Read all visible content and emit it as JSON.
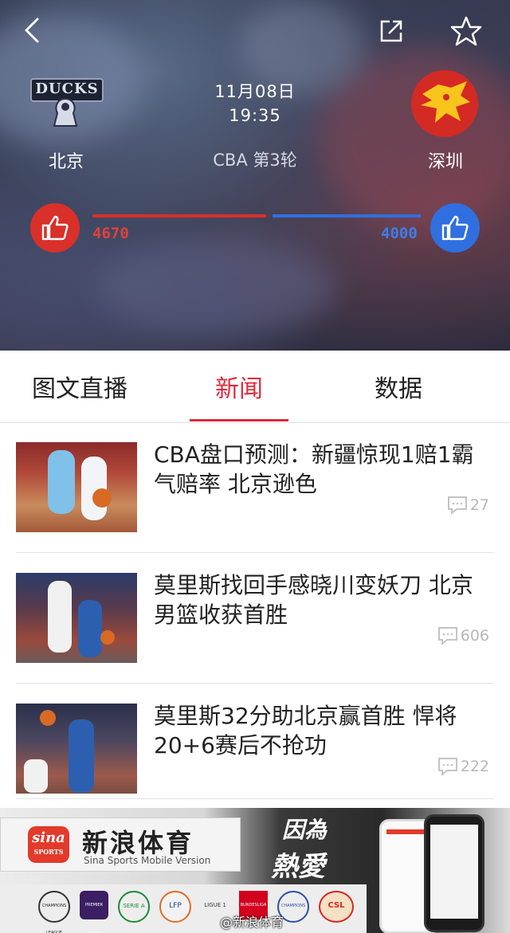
{
  "match": {
    "date": "11月08日",
    "time": "19:35",
    "round": "CBA 第3轮",
    "home": {
      "name": "北京",
      "logo_text": "DUCKS"
    },
    "away": {
      "name": "深圳"
    },
    "home_votes": "4670",
    "away_votes": "4000"
  },
  "tabs": [
    {
      "label": "图文直播"
    },
    {
      "label": "新闻"
    },
    {
      "label": "数据"
    }
  ],
  "news": [
    {
      "title": "CBA盘口预测：新疆惊现1赔1霸气赔率 北京逊色",
      "comments": "27"
    },
    {
      "title": "莫里斯找回手感晓川变妖刀 北京男篮收获首胜",
      "comments": "606"
    },
    {
      "title": "莫里斯32分助北京赢首胜 悍将20+6赛后不抢功",
      "comments": "222"
    }
  ],
  "banner": {
    "brand": "新浪体育",
    "sina_logo": "sina",
    "sina_sub": "SPORTS",
    "subtitle": "Sina Sports Mobile Version",
    "slogan_1": "因為",
    "slogan_2": "熱愛",
    "watermark": "@新浪体育",
    "leagues": [
      "CHAMPIONS LEAGUE",
      "PREMIER LEAGUE",
      "SERIE A",
      "LFP",
      "LIGUE 1",
      "BUNDESLIGA",
      "CHAMPIONS",
      "CSL"
    ]
  },
  "colors": {
    "accent_red": "#e0283c",
    "vote_red": "#d9302a",
    "vote_blue": "#2f6fe0"
  }
}
